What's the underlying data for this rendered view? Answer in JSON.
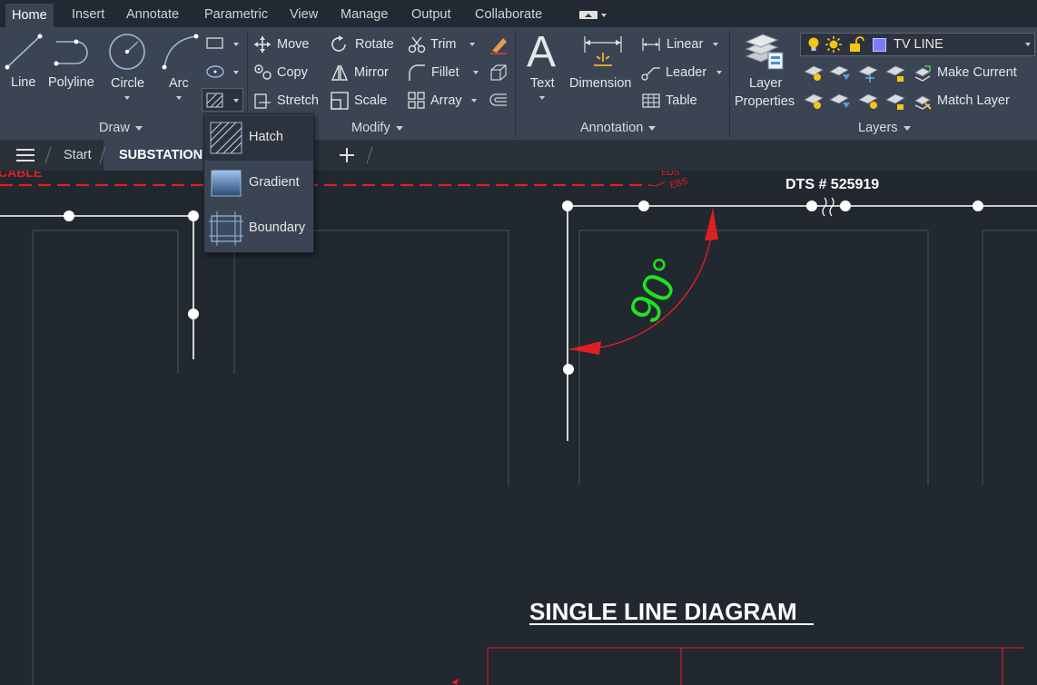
{
  "menu_tabs": [
    "Home",
    "Insert",
    "Annotate",
    "Parametric",
    "View",
    "Manage",
    "Output",
    "Collaborate"
  ],
  "draw": {
    "title": "Draw",
    "line": "Line",
    "polyline": "Polyline",
    "circle": "Circle",
    "arc": "Arc"
  },
  "modify": {
    "title": "Modify",
    "move": "Move",
    "rotate": "Rotate",
    "trim": "Trim",
    "copy": "Copy",
    "mirror": "Mirror",
    "fillet": "Fillet",
    "stretch": "Stretch",
    "scale": "Scale",
    "array": "Array"
  },
  "annotation": {
    "title": "Annotation",
    "text": "Text",
    "dimension": "Dimension",
    "linear": "Linear",
    "leader": "Leader",
    "table": "Table"
  },
  "layers": {
    "title": "Layers",
    "layer_properties_line1": "Layer",
    "layer_properties_line2": "Properties",
    "current_layer": "TV LINE",
    "current_layer_color": "#7b7bff",
    "make_current": "Make Current",
    "match_layer": "Match Layer"
  },
  "file_tabs": {
    "start": "Start",
    "active": "SUBSTATION"
  },
  "hatch_menu": {
    "hatch": "Hatch",
    "gradient": "Gradient",
    "boundary": "Boundary"
  },
  "drawing": {
    "dts_label": "DTS # 525919",
    "angle_label": "90°",
    "diagram_title": "SINGLE LINE DIAGRAM",
    "cable_fragment": "CABLE",
    "eds_label": "EDS",
    "ebs_label": "EBS"
  }
}
